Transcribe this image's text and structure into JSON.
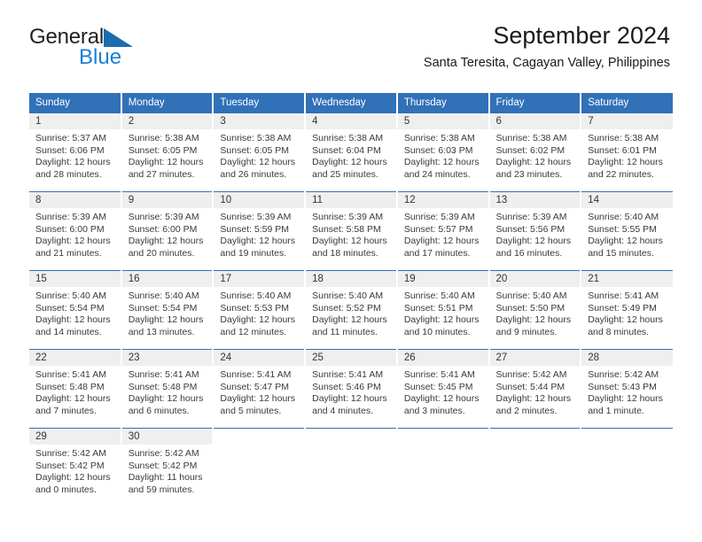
{
  "brand": {
    "name_line1": "General",
    "name_line2": "Blue",
    "logo_icon": "blue-triangle-flag-icon"
  },
  "header": {
    "title": "September 2024",
    "subtitle": "Santa Teresita, Cagayan Valley, Philippines"
  },
  "calendar": {
    "weekday_headers": [
      "Sunday",
      "Monday",
      "Tuesday",
      "Wednesday",
      "Thursday",
      "Friday",
      "Saturday"
    ],
    "accent_color": "#3071b8",
    "date_band_color": "#efefef",
    "weeks": [
      [
        {
          "day": "1",
          "sunrise": "Sunrise: 5:37 AM",
          "sunset": "Sunset: 6:06 PM",
          "daylight_line1": "Daylight: 12 hours",
          "daylight_line2": "and 28 minutes."
        },
        {
          "day": "2",
          "sunrise": "Sunrise: 5:38 AM",
          "sunset": "Sunset: 6:05 PM",
          "daylight_line1": "Daylight: 12 hours",
          "daylight_line2": "and 27 minutes."
        },
        {
          "day": "3",
          "sunrise": "Sunrise: 5:38 AM",
          "sunset": "Sunset: 6:05 PM",
          "daylight_line1": "Daylight: 12 hours",
          "daylight_line2": "and 26 minutes."
        },
        {
          "day": "4",
          "sunrise": "Sunrise: 5:38 AM",
          "sunset": "Sunset: 6:04 PM",
          "daylight_line1": "Daylight: 12 hours",
          "daylight_line2": "and 25 minutes."
        },
        {
          "day": "5",
          "sunrise": "Sunrise: 5:38 AM",
          "sunset": "Sunset: 6:03 PM",
          "daylight_line1": "Daylight: 12 hours",
          "daylight_line2": "and 24 minutes."
        },
        {
          "day": "6",
          "sunrise": "Sunrise: 5:38 AM",
          "sunset": "Sunset: 6:02 PM",
          "daylight_line1": "Daylight: 12 hours",
          "daylight_line2": "and 23 minutes."
        },
        {
          "day": "7",
          "sunrise": "Sunrise: 5:38 AM",
          "sunset": "Sunset: 6:01 PM",
          "daylight_line1": "Daylight: 12 hours",
          "daylight_line2": "and 22 minutes."
        }
      ],
      [
        {
          "day": "8",
          "sunrise": "Sunrise: 5:39 AM",
          "sunset": "Sunset: 6:00 PM",
          "daylight_line1": "Daylight: 12 hours",
          "daylight_line2": "and 21 minutes."
        },
        {
          "day": "9",
          "sunrise": "Sunrise: 5:39 AM",
          "sunset": "Sunset: 6:00 PM",
          "daylight_line1": "Daylight: 12 hours",
          "daylight_line2": "and 20 minutes."
        },
        {
          "day": "10",
          "sunrise": "Sunrise: 5:39 AM",
          "sunset": "Sunset: 5:59 PM",
          "daylight_line1": "Daylight: 12 hours",
          "daylight_line2": "and 19 minutes."
        },
        {
          "day": "11",
          "sunrise": "Sunrise: 5:39 AM",
          "sunset": "Sunset: 5:58 PM",
          "daylight_line1": "Daylight: 12 hours",
          "daylight_line2": "and 18 minutes."
        },
        {
          "day": "12",
          "sunrise": "Sunrise: 5:39 AM",
          "sunset": "Sunset: 5:57 PM",
          "daylight_line1": "Daylight: 12 hours",
          "daylight_line2": "and 17 minutes."
        },
        {
          "day": "13",
          "sunrise": "Sunrise: 5:39 AM",
          "sunset": "Sunset: 5:56 PM",
          "daylight_line1": "Daylight: 12 hours",
          "daylight_line2": "and 16 minutes."
        },
        {
          "day": "14",
          "sunrise": "Sunrise: 5:40 AM",
          "sunset": "Sunset: 5:55 PM",
          "daylight_line1": "Daylight: 12 hours",
          "daylight_line2": "and 15 minutes."
        }
      ],
      [
        {
          "day": "15",
          "sunrise": "Sunrise: 5:40 AM",
          "sunset": "Sunset: 5:54 PM",
          "daylight_line1": "Daylight: 12 hours",
          "daylight_line2": "and 14 minutes."
        },
        {
          "day": "16",
          "sunrise": "Sunrise: 5:40 AM",
          "sunset": "Sunset: 5:54 PM",
          "daylight_line1": "Daylight: 12 hours",
          "daylight_line2": "and 13 minutes."
        },
        {
          "day": "17",
          "sunrise": "Sunrise: 5:40 AM",
          "sunset": "Sunset: 5:53 PM",
          "daylight_line1": "Daylight: 12 hours",
          "daylight_line2": "and 12 minutes."
        },
        {
          "day": "18",
          "sunrise": "Sunrise: 5:40 AM",
          "sunset": "Sunset: 5:52 PM",
          "daylight_line1": "Daylight: 12 hours",
          "daylight_line2": "and 11 minutes."
        },
        {
          "day": "19",
          "sunrise": "Sunrise: 5:40 AM",
          "sunset": "Sunset: 5:51 PM",
          "daylight_line1": "Daylight: 12 hours",
          "daylight_line2": "and 10 minutes."
        },
        {
          "day": "20",
          "sunrise": "Sunrise: 5:40 AM",
          "sunset": "Sunset: 5:50 PM",
          "daylight_line1": "Daylight: 12 hours",
          "daylight_line2": "and 9 minutes."
        },
        {
          "day": "21",
          "sunrise": "Sunrise: 5:41 AM",
          "sunset": "Sunset: 5:49 PM",
          "daylight_line1": "Daylight: 12 hours",
          "daylight_line2": "and 8 minutes."
        }
      ],
      [
        {
          "day": "22",
          "sunrise": "Sunrise: 5:41 AM",
          "sunset": "Sunset: 5:48 PM",
          "daylight_line1": "Daylight: 12 hours",
          "daylight_line2": "and 7 minutes."
        },
        {
          "day": "23",
          "sunrise": "Sunrise: 5:41 AM",
          "sunset": "Sunset: 5:48 PM",
          "daylight_line1": "Daylight: 12 hours",
          "daylight_line2": "and 6 minutes."
        },
        {
          "day": "24",
          "sunrise": "Sunrise: 5:41 AM",
          "sunset": "Sunset: 5:47 PM",
          "daylight_line1": "Daylight: 12 hours",
          "daylight_line2": "and 5 minutes."
        },
        {
          "day": "25",
          "sunrise": "Sunrise: 5:41 AM",
          "sunset": "Sunset: 5:46 PM",
          "daylight_line1": "Daylight: 12 hours",
          "daylight_line2": "and 4 minutes."
        },
        {
          "day": "26",
          "sunrise": "Sunrise: 5:41 AM",
          "sunset": "Sunset: 5:45 PM",
          "daylight_line1": "Daylight: 12 hours",
          "daylight_line2": "and 3 minutes."
        },
        {
          "day": "27",
          "sunrise": "Sunrise: 5:42 AM",
          "sunset": "Sunset: 5:44 PM",
          "daylight_line1": "Daylight: 12 hours",
          "daylight_line2": "and 2 minutes."
        },
        {
          "day": "28",
          "sunrise": "Sunrise: 5:42 AM",
          "sunset": "Sunset: 5:43 PM",
          "daylight_line1": "Daylight: 12 hours",
          "daylight_line2": "and 1 minute."
        }
      ],
      [
        {
          "day": "29",
          "sunrise": "Sunrise: 5:42 AM",
          "sunset": "Sunset: 5:42 PM",
          "daylight_line1": "Daylight: 12 hours",
          "daylight_line2": "and 0 minutes."
        },
        {
          "day": "30",
          "sunrise": "Sunrise: 5:42 AM",
          "sunset": "Sunset: 5:42 PM",
          "daylight_line1": "Daylight: 11 hours",
          "daylight_line2": "and 59 minutes."
        },
        null,
        null,
        null,
        null,
        null
      ]
    ]
  }
}
